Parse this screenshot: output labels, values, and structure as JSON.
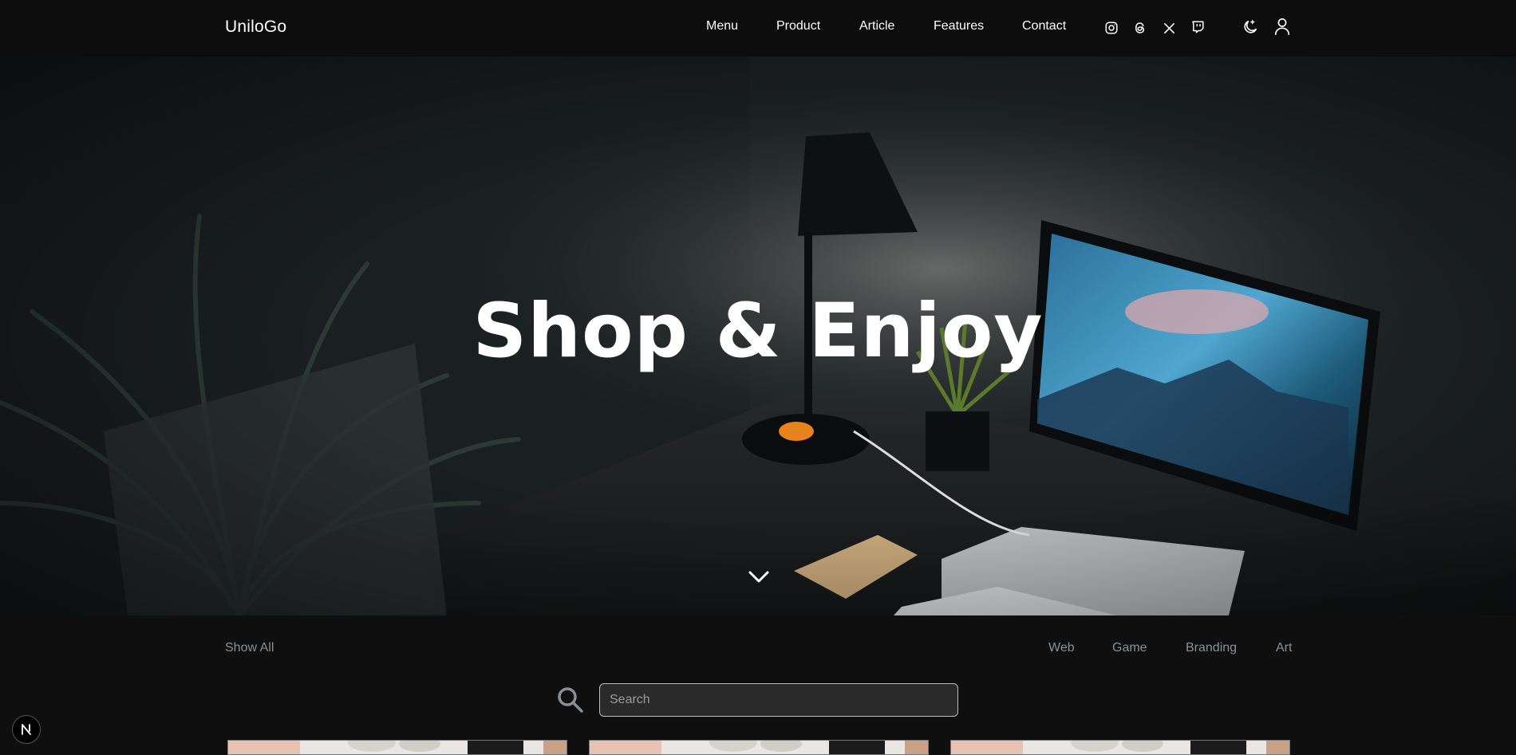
{
  "header": {
    "brand": "UniloGo",
    "nav": [
      "Menu",
      "Product",
      "Article",
      "Features",
      "Contact"
    ],
    "social_icons": [
      "instagram-icon",
      "threads-icon",
      "x-icon",
      "twitch-icon"
    ],
    "theme_toggle_icon": "moon-icon",
    "account_icon": "user-icon"
  },
  "hero": {
    "title": "Shop & Enjoy",
    "scroll_icon": "chevron-down-icon"
  },
  "filters": {
    "show_all": "Show All",
    "categories": [
      "Web",
      "Game",
      "Branding",
      "Art"
    ]
  },
  "search": {
    "placeholder": "Search",
    "value": ""
  },
  "badge": {
    "label": "N"
  },
  "colors": {
    "background": "#0f0f0f",
    "header": "#0d0d0d",
    "filter_text": "#8a8f96",
    "search_bg": "#2a2a2a"
  }
}
